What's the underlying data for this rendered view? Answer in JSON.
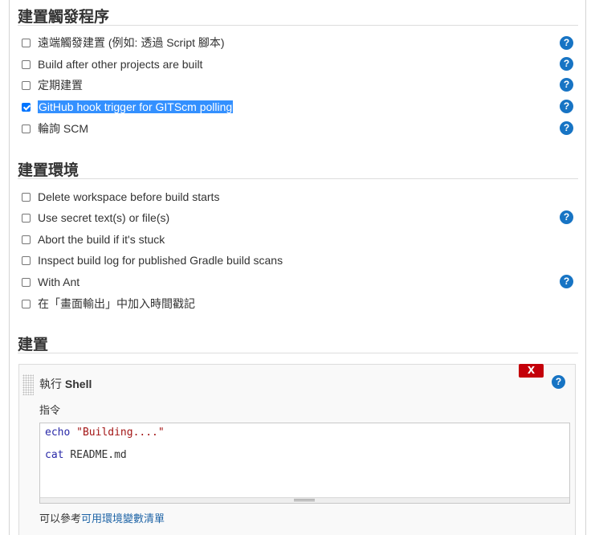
{
  "triggers": {
    "title": "建置觸發程序",
    "options": [
      {
        "label": "遠端觸發建置 (例如: 透過 Script 腳本)",
        "checked": false,
        "help": true
      },
      {
        "label": "Build after other projects are built",
        "checked": false,
        "help": true
      },
      {
        "label": "定期建置",
        "checked": false,
        "help": true
      },
      {
        "label": "GitHub hook trigger for GITScm polling",
        "checked": true,
        "help": true
      },
      {
        "label": "輪詢 SCM",
        "checked": false,
        "help": true
      }
    ]
  },
  "environment": {
    "title": "建置環境",
    "options": [
      {
        "label": "Delete workspace before build starts",
        "checked": false,
        "help": false
      },
      {
        "label": "Use secret text(s) or file(s)",
        "checked": false,
        "help": true
      },
      {
        "label": "Abort the build if it's stuck",
        "checked": false,
        "help": false
      },
      {
        "label": "Inspect build log for published Gradle build scans",
        "checked": false,
        "help": false
      },
      {
        "label": "With Ant",
        "checked": false,
        "help": true
      },
      {
        "label": "在「畫面輸出」中加入時間戳記",
        "checked": false,
        "help": false
      }
    ]
  },
  "build": {
    "title": "建置",
    "step": {
      "title_prefix": "執行",
      "title_bold": "Shell",
      "delete_label": "X",
      "command_label": "指令",
      "code_lines": [
        {
          "keyword": "echo",
          "rest": "\"Building....\""
        },
        {
          "keyword": "cat",
          "rest": "README.md"
        }
      ],
      "env_note_prefix": "可以參考",
      "env_link": "可用環境變數清單"
    }
  },
  "help_label": "?",
  "colors": {
    "help": "#1774c4",
    "delete": "#c4000a",
    "selection": "#3390ff",
    "link": "#1e64a6"
  }
}
